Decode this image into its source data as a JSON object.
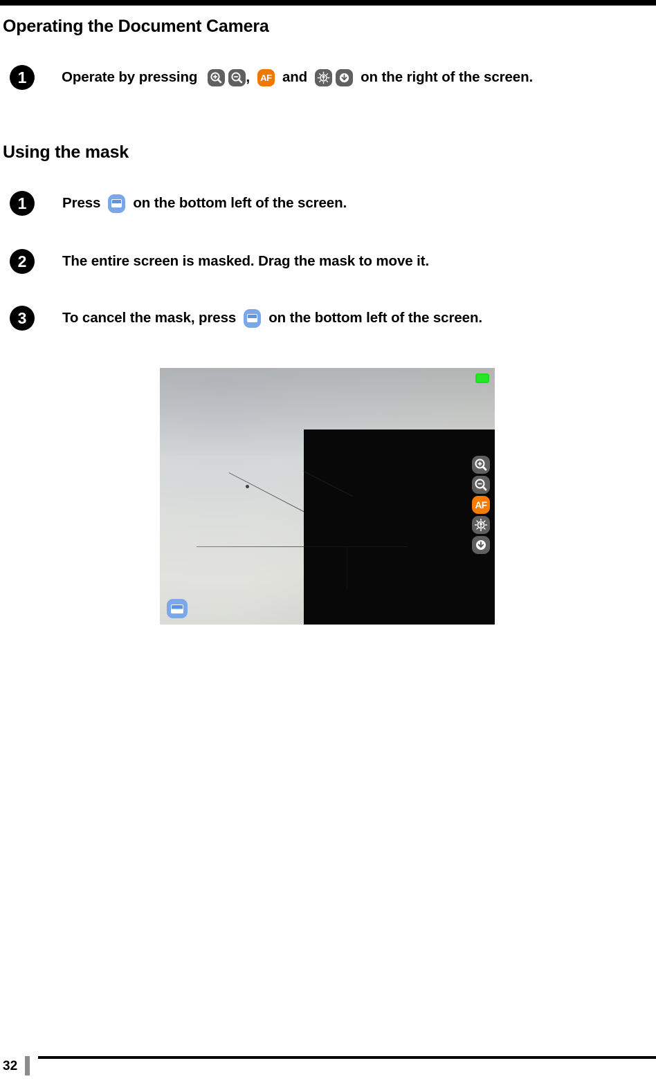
{
  "document": {
    "page_number": "32"
  },
  "sections": [
    {
      "id": "operating-the-document-camera",
      "title": "Operating the Document Camera",
      "steps": [
        {
          "number": "1",
          "text_before": "Operate by pressing",
          "text_middle": ",",
          "text_and": "and",
          "text_after": "on the right of the screen.",
          "icons": [
            "zoom-in-icon",
            "zoom-out-icon",
            "af-icon",
            "brightness-icon",
            "download-icon"
          ]
        }
      ]
    },
    {
      "id": "using-the-mask",
      "title": "Using the mask",
      "steps": [
        {
          "number": "1",
          "text_before": "Press",
          "text_after": "on the bottom left of the screen.",
          "icons": [
            "mask-icon"
          ]
        },
        {
          "number": "2",
          "text_before": "The entire screen is masked. Drag the mask to move it.",
          "text_after": "",
          "icons": []
        },
        {
          "number": "3",
          "text_before": "To cancel the mask, press",
          "text_after": "on the bottom left of the screen.",
          "icons": [
            "mask-icon"
          ]
        }
      ]
    }
  ],
  "figure": {
    "name": "document-camera-screen-with-mask",
    "alt": "Document camera live view of a sheet of paper with pencil lines, the right half covered by a black mask",
    "toolbar_buttons": [
      {
        "name": "zoom-in-button",
        "label": ""
      },
      {
        "name": "zoom-out-button",
        "label": ""
      },
      {
        "name": "af-button",
        "label": "AF"
      },
      {
        "name": "brightness-button",
        "label": ""
      },
      {
        "name": "download-button",
        "label": ""
      }
    ],
    "mask_button": {
      "name": "mask-button",
      "label": ""
    },
    "mask_indicator": {
      "name": "mask-indicator",
      "label": ""
    }
  },
  "icon_labels": {
    "af": "AF"
  },
  "colors": {
    "accent_orange": "#f57c00",
    "button_grey": "#5f5f5f",
    "mask_blue": "#7aa8ea",
    "indicator_green": "#27e527",
    "mask_black": "#080808"
  }
}
